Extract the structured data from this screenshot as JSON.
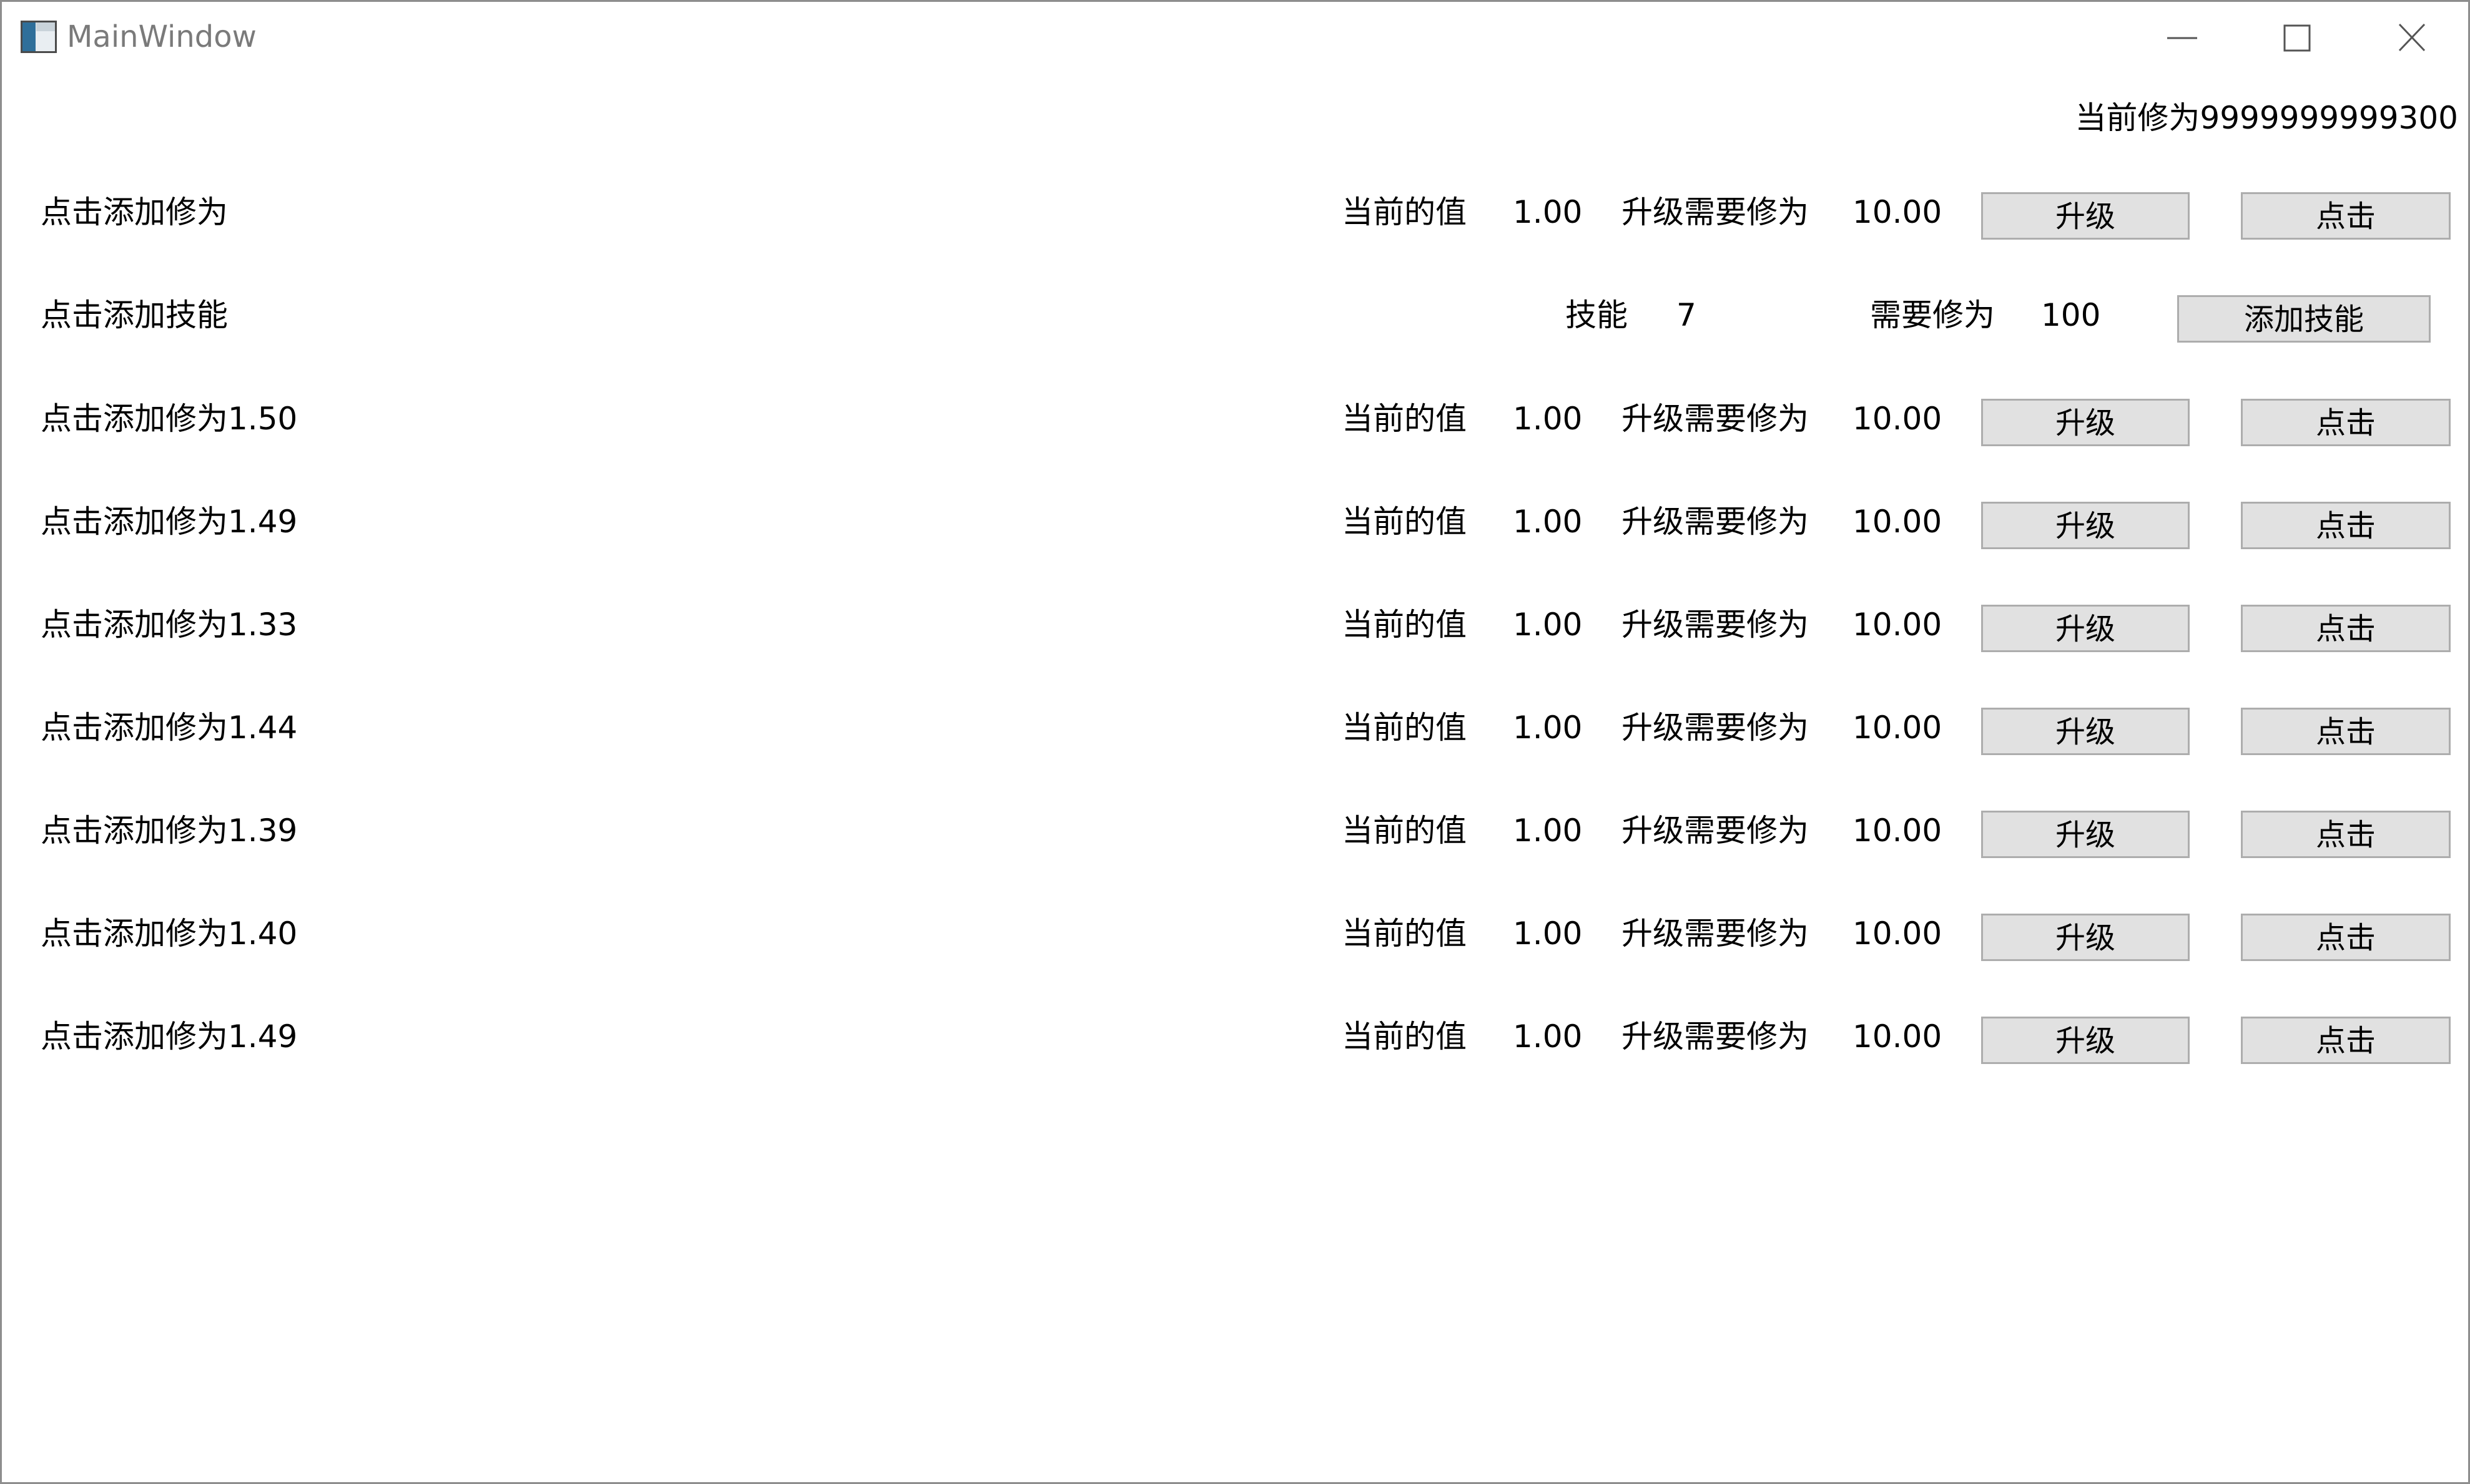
{
  "window": {
    "title": "MainWindow",
    "controls": {
      "minimize": "minimize",
      "maximize": "maximize",
      "close": "close"
    }
  },
  "cultivation_total": "当前修为9999999999300",
  "main_row": {
    "label": "点击添加修为",
    "current_label": "当前的值",
    "current_value": "1.00",
    "need_label": "升级需要修为",
    "need_value": "10.00",
    "upgrade_button": "升级",
    "click_button": "点击"
  },
  "skill_row": {
    "label": "点击添加技能",
    "skill_label": "技能",
    "skill_value": "7",
    "need_label": "需要修为",
    "need_value": "100",
    "add_button": "添加技能"
  },
  "rows": [
    {
      "label": "点击添加修为1.50",
      "current_label": "当前的值",
      "current_value": "1.00",
      "need_label": "升级需要修为",
      "need_value": "10.00",
      "upgrade_button": "升级",
      "click_button": "点击"
    },
    {
      "label": "点击添加修为1.49",
      "current_label": "当前的值",
      "current_value": "1.00",
      "need_label": "升级需要修为",
      "need_value": "10.00",
      "upgrade_button": "升级",
      "click_button": "点击"
    },
    {
      "label": "点击添加修为1.33",
      "current_label": "当前的值",
      "current_value": "1.00",
      "need_label": "升级需要修为",
      "need_value": "10.00",
      "upgrade_button": "升级",
      "click_button": "点击"
    },
    {
      "label": "点击添加修为1.44",
      "current_label": "当前的值",
      "current_value": "1.00",
      "need_label": "升级需要修为",
      "need_value": "10.00",
      "upgrade_button": "升级",
      "click_button": "点击"
    },
    {
      "label": "点击添加修为1.39",
      "current_label": "当前的值",
      "current_value": "1.00",
      "need_label": "升级需要修为",
      "need_value": "10.00",
      "upgrade_button": "升级",
      "click_button": "点击"
    },
    {
      "label": "点击添加修为1.40",
      "current_label": "当前的值",
      "current_value": "1.00",
      "need_label": "升级需要修为",
      "need_value": "10.00",
      "upgrade_button": "升级",
      "click_button": "点击"
    },
    {
      "label": "点击添加修为1.49",
      "current_label": "当前的值",
      "current_value": "1.00",
      "need_label": "升级需要修为",
      "need_value": "10.00",
      "upgrade_button": "升级",
      "click_button": "点击"
    }
  ]
}
